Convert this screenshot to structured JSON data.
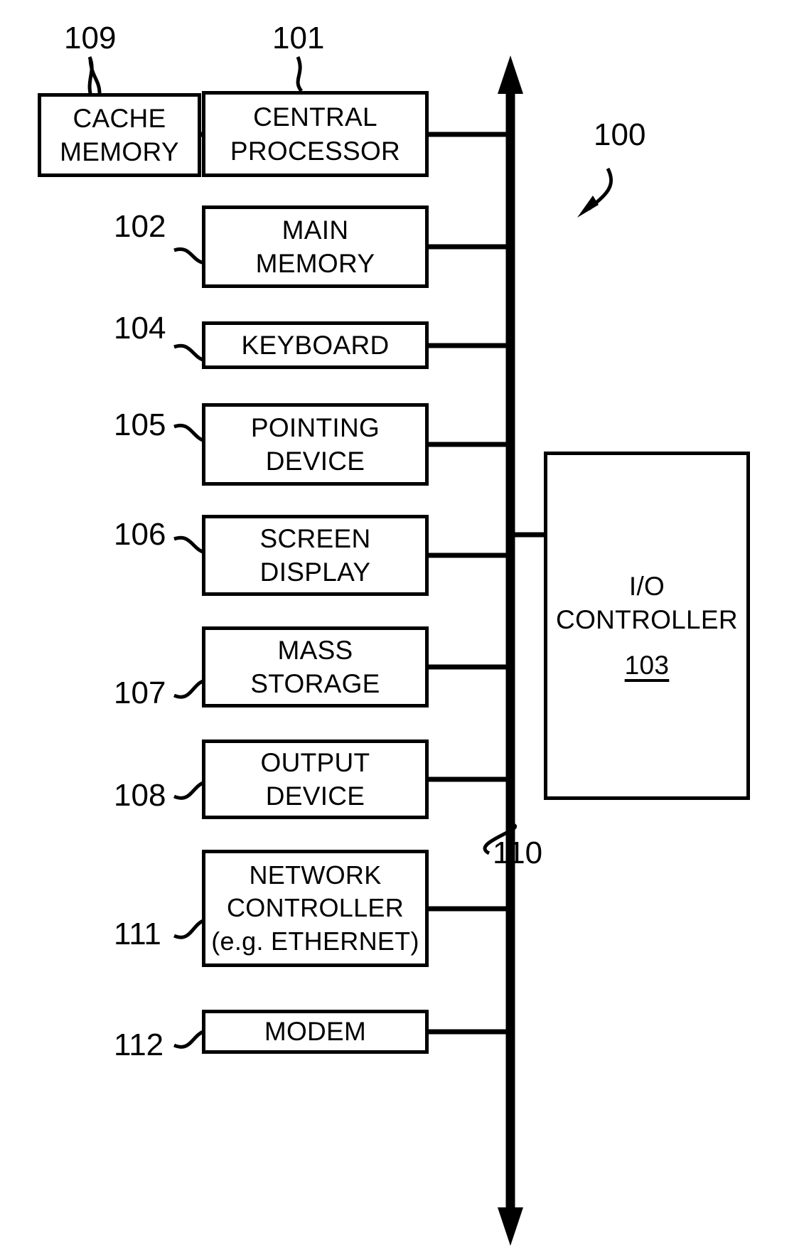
{
  "figure": {
    "title": "Computer system block diagram",
    "system_ref": "100",
    "bus_ref": "110",
    "stroke_color": "#000000",
    "background_color": "#ffffff"
  },
  "blocks": {
    "cache_memory": {
      "ref": "109",
      "line1": "CACHE",
      "line2": "MEMORY"
    },
    "central_processor": {
      "ref": "101",
      "line1": "CENTRAL",
      "line2": "PROCESSOR"
    },
    "main_memory": {
      "ref": "102",
      "line1": "MAIN",
      "line2": "MEMORY"
    },
    "keyboard": {
      "ref": "104",
      "line1": "KEYBOARD",
      "line2": ""
    },
    "pointing_device": {
      "ref": "105",
      "line1": "POINTING",
      "line2": "DEVICE"
    },
    "screen_display": {
      "ref": "106",
      "line1": "SCREEN",
      "line2": "DISPLAY"
    },
    "mass_storage": {
      "ref": "107",
      "line1": "MASS",
      "line2": "STORAGE"
    },
    "output_device": {
      "ref": "108",
      "line1": "OUTPUT",
      "line2": "DEVICE"
    },
    "network_controller": {
      "ref": "111",
      "line1": "NETWORK",
      "line2": "CONTROLLER",
      "line3": "(e.g. ETHERNET)"
    },
    "modem": {
      "ref": "112",
      "line1": "MODEM",
      "line2": ""
    },
    "io_controller": {
      "ref": "103",
      "line1": "I/O",
      "line2": "CONTROLLER"
    }
  }
}
